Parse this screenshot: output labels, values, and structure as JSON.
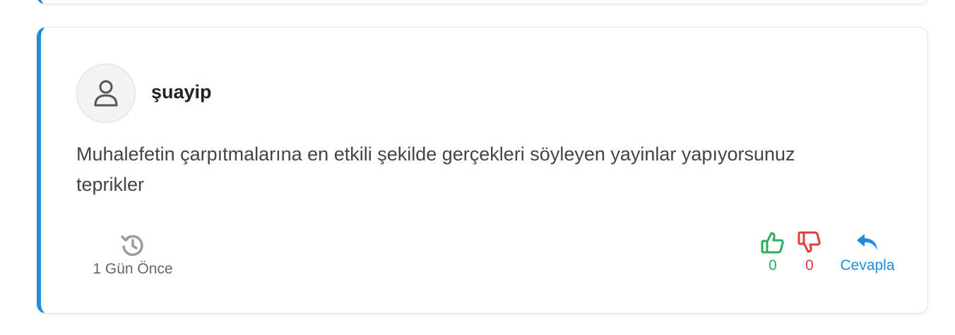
{
  "comment": {
    "author": "şuayip",
    "text": "Muhalefetin çarpıtmalarına en etkili şekilde gerçekleri söyleyen yayinlar yapıyorsunuz teprikler",
    "time": "1 Gün Önce",
    "likes": "0",
    "dislikes": "0",
    "reply_label": "Cevapla"
  },
  "colors": {
    "accent": "#1e8ddd",
    "like": "#27ae60",
    "dislike": "#e03c3c"
  },
  "icons": {
    "avatar": "user-icon",
    "time": "history-icon",
    "like": "thumbs-up-icon",
    "dislike": "thumbs-down-icon",
    "reply": "reply-icon"
  }
}
